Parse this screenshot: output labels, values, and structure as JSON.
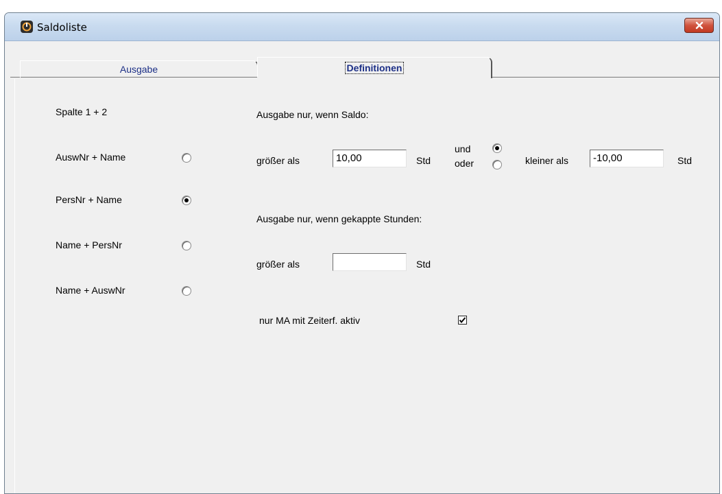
{
  "window": {
    "title": "Saldoliste",
    "close_icon": "close-icon"
  },
  "tabs": [
    {
      "label": "Ausgabe",
      "active": false
    },
    {
      "label": "Definitionen",
      "active": true
    }
  ],
  "columns": {
    "heading": "Spalte 1 + 2",
    "options": [
      {
        "label": "AuswNr + Name",
        "checked": false
      },
      {
        "label": "PersNr + Name",
        "checked": true
      },
      {
        "label": "Name + PersNr",
        "checked": false
      },
      {
        "label": "Name + AuswNr",
        "checked": false
      }
    ]
  },
  "saldo": {
    "heading": "Ausgabe nur, wenn Saldo:",
    "greater_label": "größer als",
    "greater_value": "10,00",
    "unit1": "Std",
    "und_label": "und",
    "oder_label": "oder",
    "und_checked": true,
    "oder_checked": false,
    "smaller_label": "kleiner als",
    "smaller_value": "-10,00",
    "unit2": "Std"
  },
  "capped": {
    "heading": "Ausgabe nur, wenn gekappte Stunden:",
    "greater_label": "größer als",
    "greater_value": "",
    "unit": "Std"
  },
  "active_filter": {
    "label": "nur MA mit Zeiterf. aktiv",
    "checked": true
  }
}
